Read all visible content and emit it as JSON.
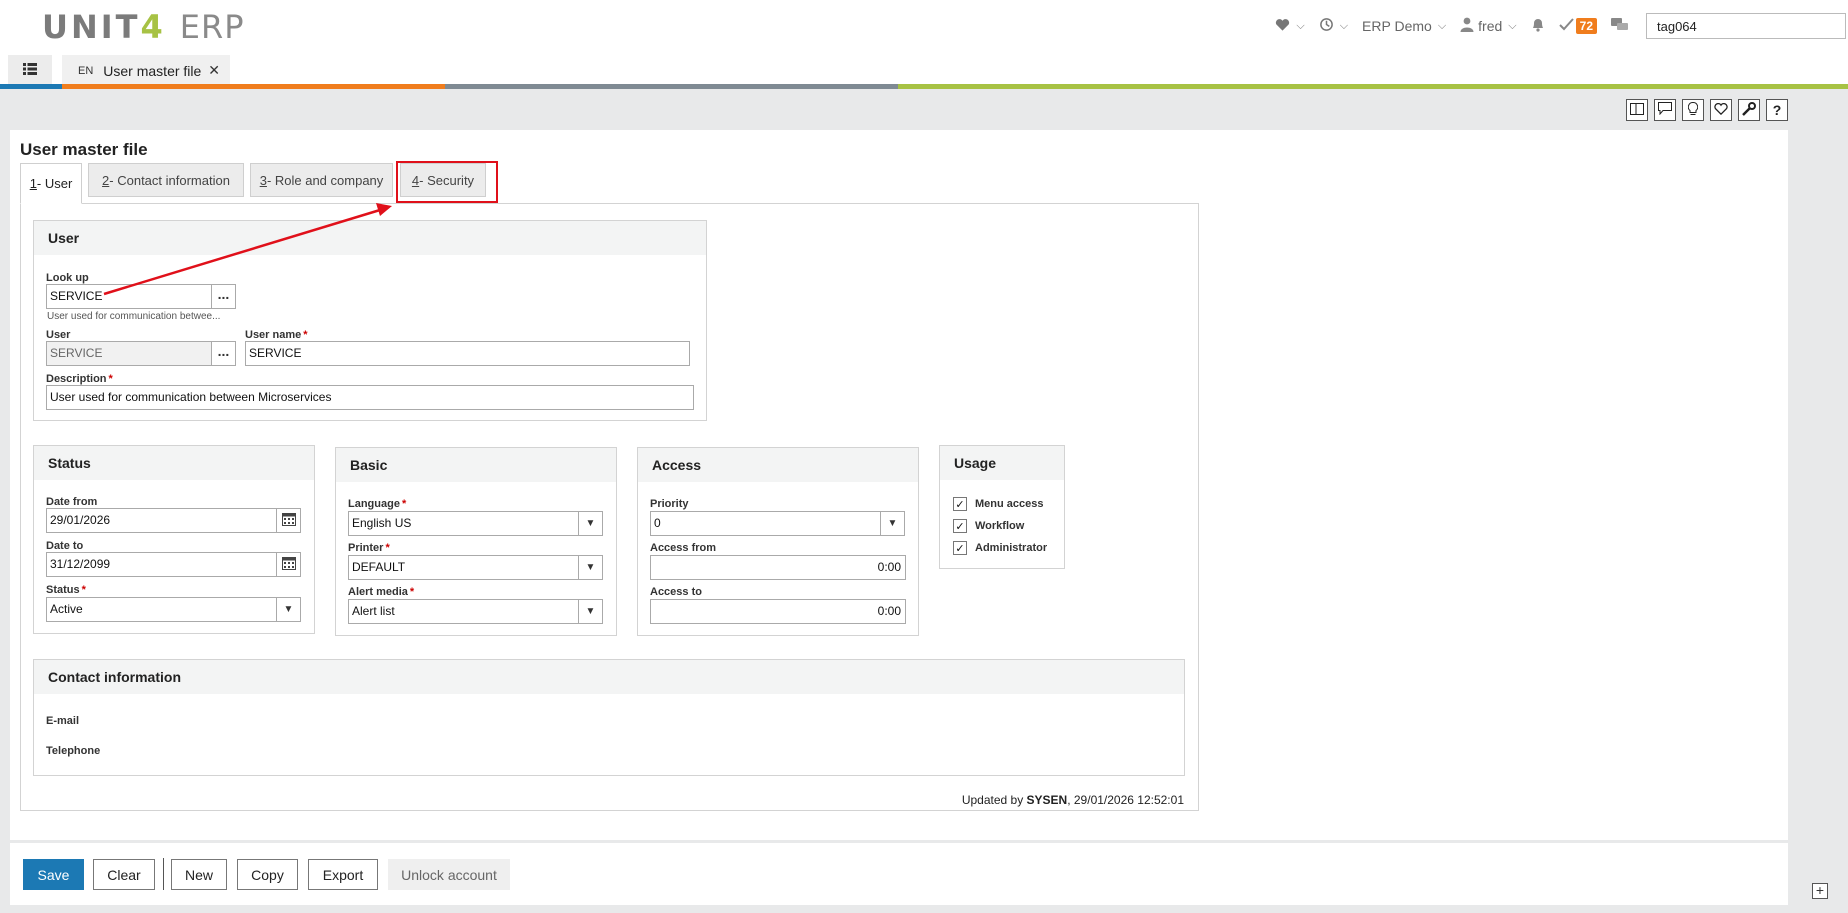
{
  "header": {
    "logo_unit": "UNIT",
    "logo_four": "4",
    "logo_erp": "ERP",
    "company": "ERP Demo",
    "user": "fred",
    "task_count": "72",
    "search_value": "tag064"
  },
  "tabbar": {
    "lang": "EN",
    "app_title": "User master file",
    "close": "✕"
  },
  "page": {
    "title": "User master file",
    "tabs": [
      {
        "num": "1",
        "label": " - User"
      },
      {
        "num": "2",
        "label": " - Contact information"
      },
      {
        "num": "3",
        "label": " - Role and company"
      },
      {
        "num": "4",
        "label": " - Security"
      }
    ]
  },
  "user_group": {
    "title": "User",
    "lookup_label": "Look up",
    "lookup_value": "SERVICE",
    "lookup_hint": "User used for communication betwee...",
    "user_label": "User",
    "user_value": "SERVICE",
    "username_label": "User name",
    "username_value": "SERVICE",
    "description_label": "Description",
    "description_value": "User used for communication between Microservices",
    "dots": "..."
  },
  "status_group": {
    "title": "Status",
    "date_from_label": "Date from",
    "date_from_value": "29/01/2026",
    "date_to_label": "Date to",
    "date_to_value": "31/12/2099",
    "status_label": "Status",
    "status_value": "Active"
  },
  "basic_group": {
    "title": "Basic",
    "language_label": "Language",
    "language_value": "English US",
    "printer_label": "Printer",
    "printer_value": "DEFAULT",
    "alert_label": "Alert media",
    "alert_value": "Alert list"
  },
  "access_group": {
    "title": "Access",
    "priority_label": "Priority",
    "priority_value": "0",
    "from_label": "Access from",
    "from_value": "0:00",
    "to_label": "Access to",
    "to_value": "0:00"
  },
  "usage_group": {
    "title": "Usage",
    "items": [
      {
        "label": "Menu access",
        "checked": true
      },
      {
        "label": "Workflow",
        "checked": true
      },
      {
        "label": "Administrator",
        "checked": true
      }
    ],
    "check_mark": "✓"
  },
  "contact_group": {
    "title": "Contact information",
    "email_label": "E-mail",
    "phone_label": "Telephone"
  },
  "updated": {
    "prefix": "Updated by ",
    "user": "SYSEN",
    "suffix": ", 29/01/2026 12:52:01"
  },
  "buttons": {
    "save": "Save",
    "clear": "Clear",
    "new": "New",
    "copy": "Copy",
    "export": "Export",
    "unlock": "Unlock account"
  },
  "colors": {
    "primary": "#1c79b4",
    "strip_orange": "#f07d1d",
    "strip_gray": "#7f8a93",
    "strip_green": "#a7c244",
    "badge": "#f07d1d",
    "highlight": "#e0101a"
  }
}
